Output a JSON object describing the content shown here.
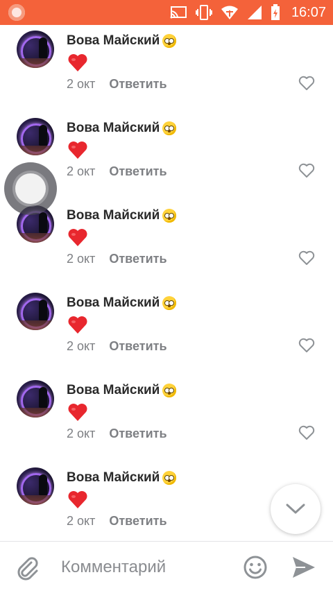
{
  "status_bar": {
    "time": "16:07",
    "bg_color": "#f4623a",
    "icons": [
      "notification-dot-icon",
      "cast-icon",
      "vibrate-icon",
      "wifi-icon",
      "signal-icon",
      "battery-icon"
    ]
  },
  "comments": [
    {
      "author": "Вова Майский",
      "message_icon": "red-heart-emoji",
      "date": "2 окт",
      "reply_label": "Ответить"
    },
    {
      "author": "Вова Майский",
      "message_icon": "red-heart-emoji",
      "date": "2 окт",
      "reply_label": "Ответить"
    },
    {
      "author": "Вова Майский",
      "message_icon": "red-heart-emoji",
      "date": "2 окт",
      "reply_label": "Ответить"
    },
    {
      "author": "Вова Майский",
      "message_icon": "red-heart-emoji",
      "date": "2 окт",
      "reply_label": "Ответить"
    },
    {
      "author": "Вова Майский",
      "message_icon": "red-heart-emoji",
      "date": "2 окт",
      "reply_label": "Ответить"
    },
    {
      "author": "Вова Майский",
      "message_icon": "red-heart-emoji",
      "date": "2 окт",
      "reply_label": "Ответить"
    }
  ],
  "composer": {
    "placeholder": "Комментарий",
    "value": ""
  },
  "colors": {
    "accent": "#f4623a",
    "heart": "#e8272e",
    "muted_text": "#7d7f83",
    "icon_gray": "#8e9296"
  }
}
